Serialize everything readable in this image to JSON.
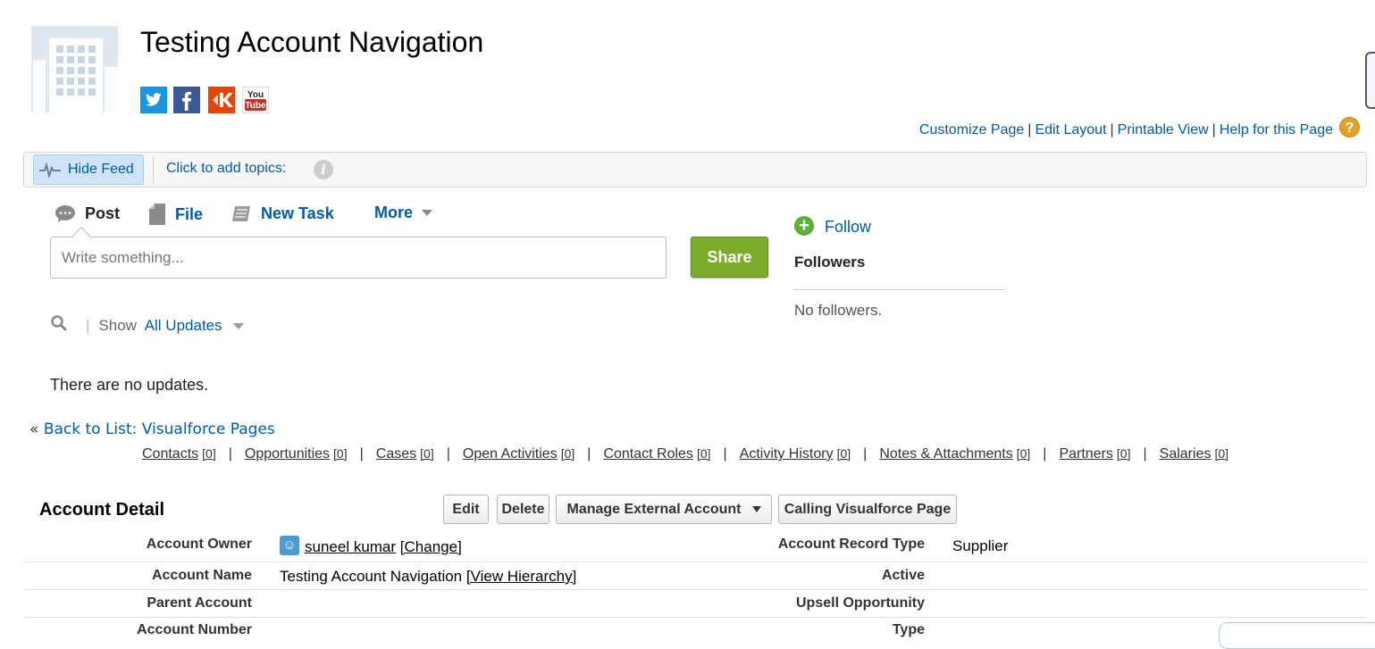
{
  "header": {
    "title": "Testing Account Navigation",
    "social": [
      {
        "name": "twitter-icon",
        "glyph": "t",
        "color": "#1b95e0"
      },
      {
        "name": "facebook-icon",
        "glyph": "f",
        "color": "#3b5998"
      },
      {
        "name": "klout-icon",
        "glyph": "K",
        "color": "#e44600"
      },
      {
        "name": "youtube-icon",
        "glyph": "You Tube",
        "color": "#c4302b"
      }
    ]
  },
  "top_links": {
    "customize": "Customize Page",
    "edit_layout": "Edit Layout",
    "printable": "Printable View",
    "help": "Help for this Page",
    "separator": "|",
    "help_icon": "?"
  },
  "feed_bar": {
    "hide_feed": "Hide Feed",
    "add_topics": "Click to add topics:",
    "info_icon": "i"
  },
  "publisher": {
    "tabs": {
      "post": "Post",
      "file": "File",
      "new_task": "New Task",
      "more": "More"
    },
    "placeholder": "Write something...",
    "share": "Share"
  },
  "filter": {
    "pipe": "|",
    "show": "Show",
    "selected": "All Updates"
  },
  "feed": {
    "empty": "There are no updates."
  },
  "followers": {
    "follow": "Follow",
    "title": "Followers",
    "empty": "No followers.",
    "plus": "+"
  },
  "back_to_list": {
    "prefix": "«",
    "label": "Back to List: Visualforce Pages"
  },
  "related_lists": [
    {
      "label": "Contacts",
      "count": "[0]"
    },
    {
      "label": "Opportunities",
      "count": "[0]"
    },
    {
      "label": "Cases",
      "count": "[0]"
    },
    {
      "label": "Open Activities",
      "count": "[0]"
    },
    {
      "label": "Contact Roles",
      "count": "[0]"
    },
    {
      "label": "Activity History",
      "count": "[0]"
    },
    {
      "label": "Notes & Attachments",
      "count": "[0]"
    },
    {
      "label": "Partners",
      "count": "[0]"
    },
    {
      "label": "Salaries",
      "count": "[0]"
    }
  ],
  "related_sep": "|",
  "detail": {
    "title": "Account Detail",
    "buttons": {
      "edit": "Edit",
      "delete": "Delete",
      "manage_external": "Manage External Account",
      "calling_vf": "Calling Visualforce Page"
    },
    "fields": {
      "owner_label": "Account Owner",
      "owner_value": "suneel kumar",
      "owner_change": "[Change]",
      "record_type_label": "Account Record Type",
      "record_type_value": "Supplier",
      "name_label": "Account Name",
      "name_value": "Testing Account Navigation",
      "name_hierarchy": "[View Hierarchy]",
      "active_label": "Active",
      "parent_label": "Parent Account",
      "upsell_label": "Upsell Opportunity",
      "number_label": "Account Number",
      "type_label": "Type"
    }
  }
}
